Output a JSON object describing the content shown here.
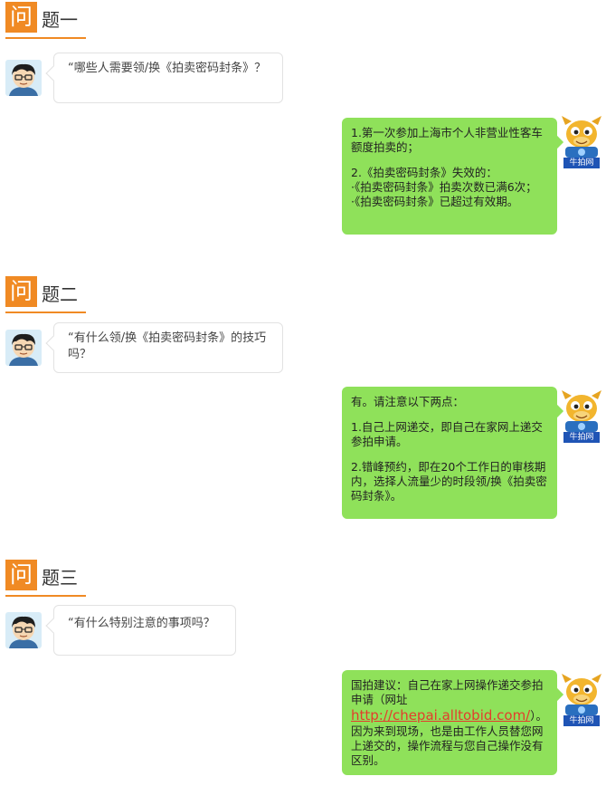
{
  "sections": [
    {
      "q_char": "问",
      "q_rest": "题一",
      "question": "“哪些人需要领/换《拍卖密码封条》？",
      "answer": {
        "lines1": [
          "1.第一次参加上海市个人非营业性客车额度拍卖的；"
        ],
        "lines2": [
          "2.《拍卖密码封条》失效的：",
          "·《拍卖密码封条》拍卖次数已满6次；",
          "·《拍卖密码封条》已超过有效期。"
        ]
      }
    },
    {
      "q_char": "问",
      "q_rest": "题二",
      "question": "“有什么领/换《拍卖密码封条》的技巧吗？",
      "answer": {
        "intro": "有。请注意以下两点：",
        "p1": "1.自己上网递交，即自己在家网上递交参拍申请。",
        "p2": "2.错峰预约，即在20个工作日的审核期内，选择人流量少的时段领/换《拍卖密码封条》。"
      }
    },
    {
      "q_char": "问",
      "q_rest": "题三",
      "question": "“有什么特别注意的事项吗？",
      "answer": {
        "pre": "国拍建议：自己在家上网操作递交参拍申请（网址",
        "link": "http://chepai.alltobid.com/",
        "post": "）。因为来到现场，也是由工作人员替您网上递交的，操作流程与您自己操作没有区别。"
      }
    }
  ],
  "bot_label": "牛拍网",
  "colors": {
    "accent": "#f08a24",
    "answer_bubble": "#8fe15a",
    "link": "#e33d2c"
  }
}
